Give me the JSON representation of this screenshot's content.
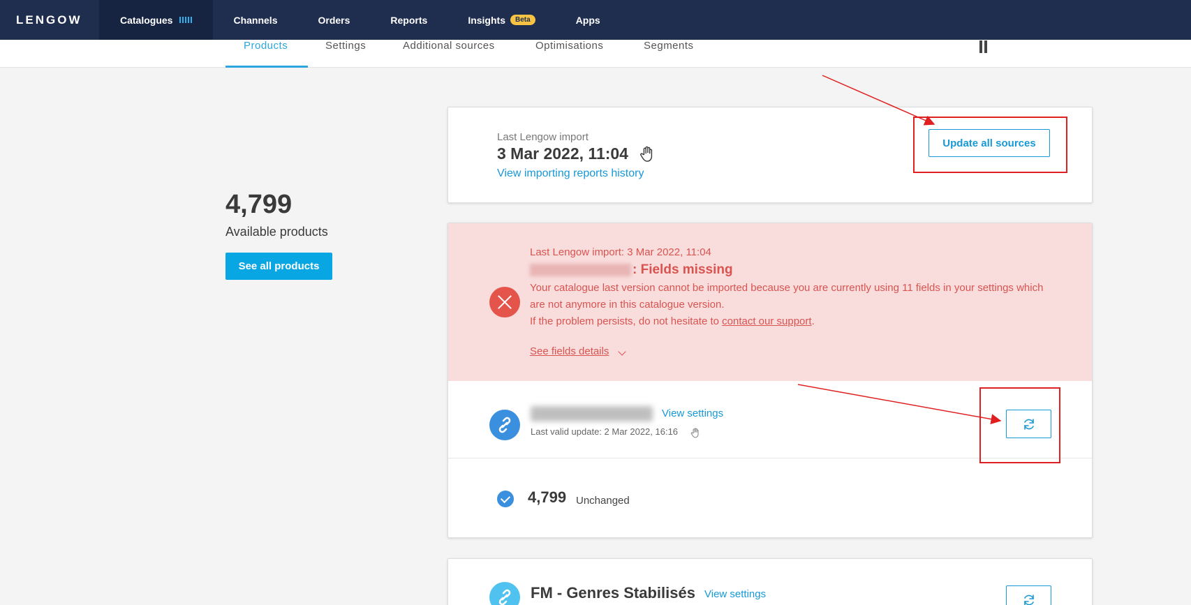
{
  "topnav": {
    "logo": "LENGOW",
    "items": [
      {
        "label": "Catalogues"
      },
      {
        "label": "Channels"
      },
      {
        "label": "Orders"
      },
      {
        "label": "Reports"
      },
      {
        "label": "Insights",
        "badge": "Beta"
      },
      {
        "label": "Apps"
      }
    ]
  },
  "subtabs": [
    "Products",
    "Settings",
    "Additional sources",
    "Optimisations",
    "Segments"
  ],
  "stats": {
    "count": "4,799",
    "label": "Available products",
    "button": "See all products"
  },
  "import_card": {
    "label": "Last Lengow import",
    "date": "3 Mar 2022, 11:04",
    "history_link": "View importing reports history",
    "update_button": "Update all sources"
  },
  "error": {
    "subtitle": "Last Lengow import: 3 Mar 2022, 11:04",
    "title": ": Fields missing",
    "message": "Your catalogue last version cannot be imported because you are currently using 11 fields in your settings which are not anymore in this catalogue version.",
    "persist_prefix": "If the problem persists, do not hesitate to ",
    "support_link": "contact our support",
    "persist_suffix": ".",
    "details_link": "See fields details"
  },
  "source": {
    "view_settings": "View settings",
    "last_update": "Last valid update: 2 Mar 2022, 16:16",
    "count": "4,799",
    "status": "Unchanged"
  },
  "source2": {
    "name": "FM - Genres Stabilisés",
    "view_settings": "View settings"
  },
  "colors": {
    "nav_bg": "#1f2d4e",
    "accent": "#1798d7",
    "error": "#d9534f",
    "error_bg": "#f9dddd",
    "annotation": "#e02020"
  }
}
